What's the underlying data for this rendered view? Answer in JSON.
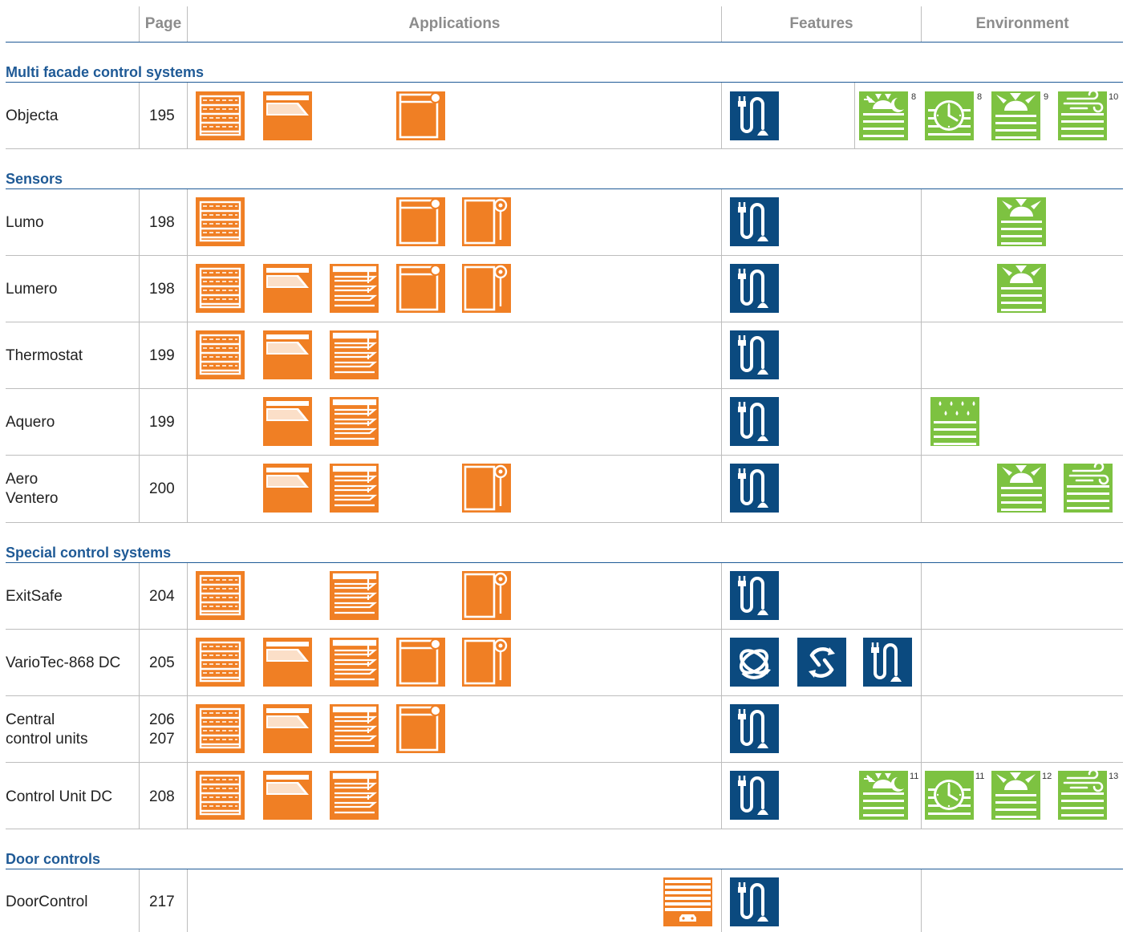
{
  "header": {
    "page": "Page",
    "applications": "Applications",
    "features": "Features",
    "environment": "Environment"
  },
  "sections": {
    "multi": "Multi facade control systems",
    "sensors": "Sensors",
    "special": "Special control systems",
    "door": "Door controls"
  },
  "rows": {
    "objecta": {
      "name": "Objecta",
      "page": "195"
    },
    "lumo": {
      "name": "Lumo",
      "page": "198"
    },
    "lumero": {
      "name": "Lumero",
      "page": "198"
    },
    "thermostat": {
      "name": "Thermostat",
      "page": "199"
    },
    "aquero": {
      "name": "Aquero",
      "page": "199"
    },
    "aero": {
      "name_line1": "Aero",
      "name_line2": "Ventero",
      "page": "200"
    },
    "exitsafe": {
      "name": "ExitSafe",
      "page": "204"
    },
    "variotec": {
      "name": "VarioTec-868 DC",
      "page": "205"
    },
    "central": {
      "name_line1": "Central",
      "name_line2": "control units",
      "page_line1": "206",
      "page_line2": "207"
    },
    "controlunit": {
      "name": "Control Unit DC",
      "page": "208"
    },
    "doorcontrol": {
      "name": "DoorControl",
      "page": "217"
    }
  },
  "footnotes": {
    "objecta": [
      "8",
      "8",
      "9",
      "10"
    ],
    "controlunit": [
      "11",
      "11",
      "12",
      "13"
    ]
  },
  "colors": {
    "application_orange": "#f07f24",
    "feature_blue": "#0b4a7f",
    "environment_green": "#7dc241",
    "section_blue": "#1f5a96",
    "header_grey": "#8c8c8c"
  }
}
